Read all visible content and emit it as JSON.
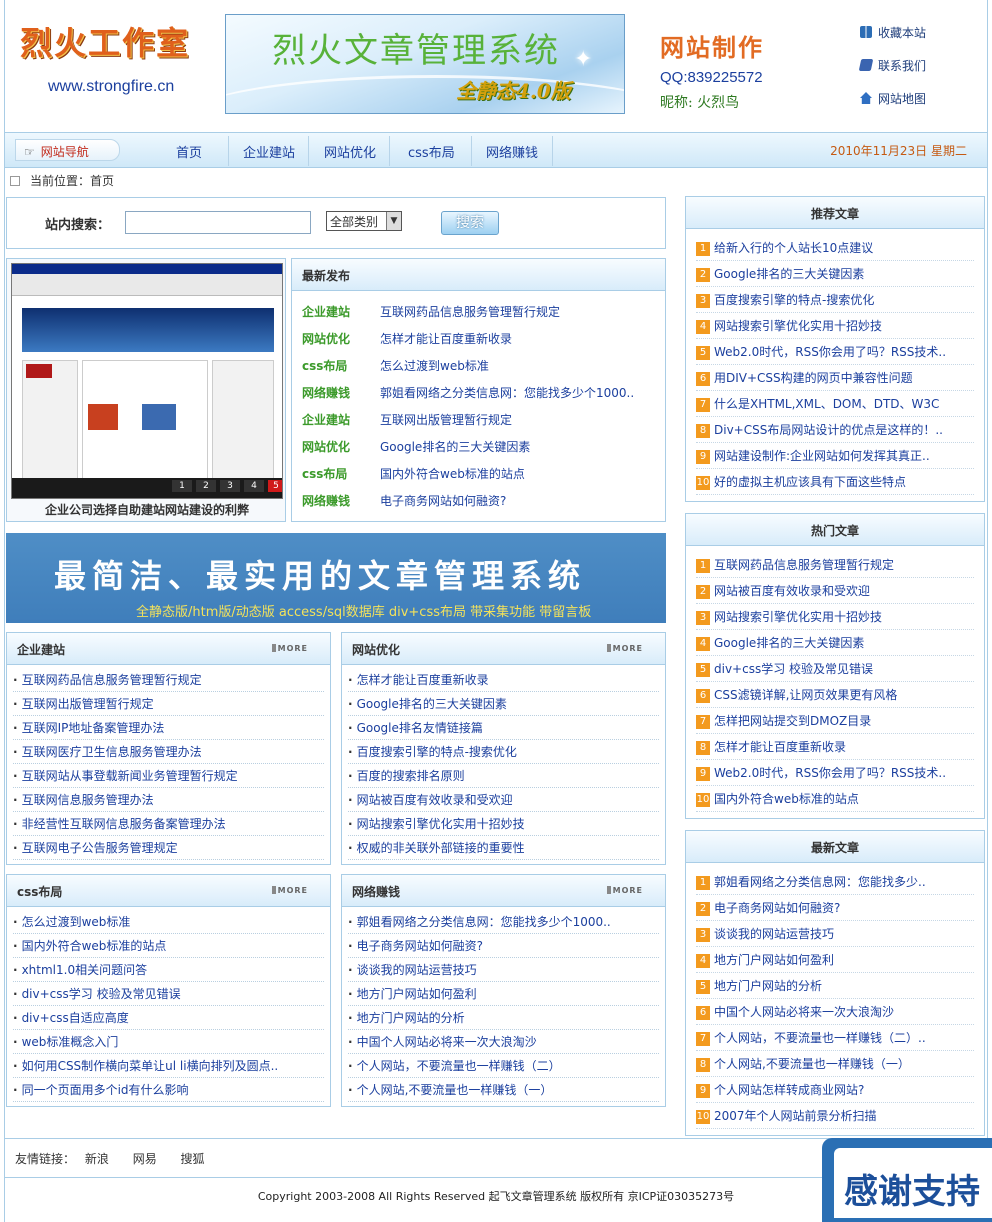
{
  "header": {
    "logo_title": "烈火工作室",
    "logo_url": "www.strongfire.cn",
    "banner_title": "烈火文章管理系统",
    "banner_subtitle": "全静态4.0版",
    "contact_title": "网站制作",
    "contact_qq": "QQ:839225572",
    "contact_nick": "昵称: 火烈鸟",
    "quick_links": [
      "收藏本站",
      "联系我们",
      "网站地图"
    ]
  },
  "nav": {
    "tag": "网站导航",
    "items": [
      "首页",
      "企业建站",
      "网站优化",
      "css布局",
      "网络赚钱"
    ],
    "date": "2010年11月23日 星期二"
  },
  "breadcrumb": "当前位置：首页",
  "search": {
    "label": "站内搜索：",
    "value": "",
    "category": "全部类别",
    "button": "搜索"
  },
  "feature": {
    "caption": "企业公司选择自助建站网站建设的利弊",
    "pages": [
      "1",
      "2",
      "3",
      "4",
      "5"
    ]
  },
  "latest": {
    "title": "最新发布",
    "items": [
      {
        "cat": "企业建站",
        "text": "互联网药品信息服务管理暂行规定"
      },
      {
        "cat": "网站优化",
        "text": "怎样才能让百度重新收录"
      },
      {
        "cat": "css布局",
        "text": "怎么过渡到web标准"
      },
      {
        "cat": "网络赚钱",
        "text": "郭姐看网络之分类信息网：您能找多少个1000.."
      },
      {
        "cat": "企业建站",
        "text": "互联网出版管理暂行规定"
      },
      {
        "cat": "网站优化",
        "text": "Google排名的三大关键因素"
      },
      {
        "cat": "css布局",
        "text": "国内外符合web标准的站点"
      },
      {
        "cat": "网络赚钱",
        "text": "电子商务网站如何融资?"
      }
    ]
  },
  "slogan": {
    "main": "最简洁、最实用的文章管理系统",
    "sub": "全静态版/htm版/动态版  access/sql数据库  div+css布局  带采集功能  带留言板"
  },
  "more_label": "MORE",
  "categories": [
    {
      "title": "企业建站",
      "items": [
        "互联网药品信息服务管理暂行规定",
        "互联网出版管理暂行规定",
        "互联网IP地址备案管理办法",
        "互联网医疗卫生信息服务管理办法",
        "互联网站从事登载新闻业务管理暂行规定",
        "互联网信息服务管理办法",
        "非经营性互联网信息服务备案管理办法",
        "互联网电子公告服务管理规定"
      ]
    },
    {
      "title": "网站优化",
      "items": [
        "怎样才能让百度重新收录",
        "Google排名的三大关键因素",
        "Google排名友情链接篇",
        "百度搜索引擎的特点-搜索优化",
        "百度的搜索排名原则",
        "网站被百度有效收录和受欢迎",
        "网站搜索引擎优化实用十招妙技",
        "权威的非关联外部链接的重要性"
      ]
    },
    {
      "title": "css布局",
      "items": [
        "怎么过渡到web标准",
        "国内外符合web标准的站点",
        "xhtml1.0相关问题问答",
        "div+css学习  校验及常见错误",
        "div+css自适应高度",
        "web标准概念入门",
        "如何用CSS制作横向菜单让ul li横向排列及圆点..",
        "同一个页面用多个id有什么影响"
      ]
    },
    {
      "title": "网络赚钱",
      "items": [
        "郭姐看网络之分类信息网：您能找多少个1000..",
        "电子商务网站如何融资?",
        "谈谈我的网站运营技巧",
        "地方门户网站如何盈利",
        "地方门户网站的分析",
        "中国个人网站必将来一次大浪淘沙",
        "个人网站，不要流量也一样赚钱（二）",
        "个人网站,不要流量也一样赚钱（一）"
      ]
    }
  ],
  "side": [
    {
      "title": "推荐文章",
      "items": [
        "给新入行的个人站长10点建议",
        "Google排名的三大关键因素",
        "百度搜索引擎的特点-搜索优化",
        "网站搜索引擎优化实用十招妙技",
        "Web2.0时代，RSS你会用了吗？RSS技术..",
        "用DIV+CSS构建的网页中兼容性问题",
        "什么是XHTML,XML、DOM、DTD、W3C",
        "Div+CSS布局网站设计的优点是这样的！..",
        "网站建设制作:企业网站如何发挥其真正..",
        "好的虚拟主机应该具有下面这些特点"
      ]
    },
    {
      "title": "热门文章",
      "items": [
        "互联网药品信息服务管理暂行规定",
        "网站被百度有效收录和受欢迎",
        "网站搜索引擎优化实用十招妙技",
        "Google排名的三大关键因素",
        "div+css学习  校验及常见错误",
        "CSS滤镜详解,让网页效果更有风格",
        "怎样把网站提交到DMOZ目录",
        "怎样才能让百度重新收录",
        "Web2.0时代，RSS你会用了吗？RSS技术..",
        "国内外符合web标准的站点"
      ]
    },
    {
      "title": "最新文章",
      "items": [
        "郭姐看网络之分类信息网：您能找多少..",
        "电子商务网站如何融资?",
        "谈谈我的网站运营技巧",
        "地方门户网站如何盈利",
        "地方门户网站的分析",
        "中国个人网站必将来一次大浪淘沙",
        "个人网站，不要流量也一样赚钱（二）..",
        "个人网站,不要流量也一样赚钱（一）",
        "个人网站怎样转成商业网站?",
        "2007年个人网站前景分析扫描"
      ]
    }
  ],
  "footer": {
    "links_label": "友情链接：",
    "links": [
      "新浪",
      "网易",
      "搜狐"
    ],
    "copyright": "Copyright 2003-2008 All Rights Reserved  起飞文章管理系统 版权所有 京ICP证03035273号",
    "thanks": "感谢支持"
  }
}
